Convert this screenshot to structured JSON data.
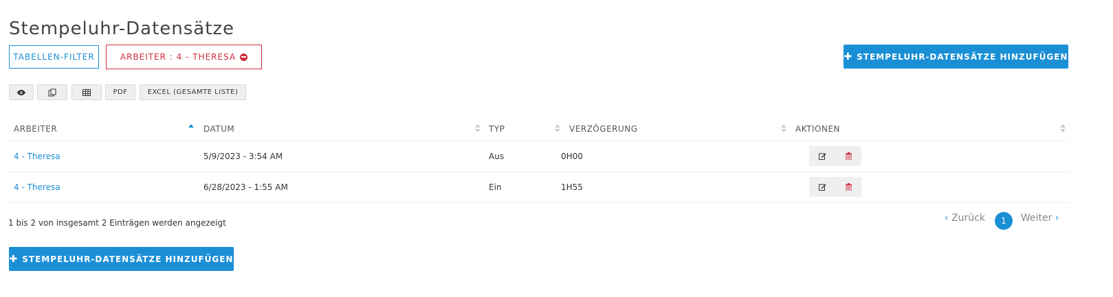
{
  "page": {
    "title": "Stempeluhr-Datensätze"
  },
  "filters": {
    "table_filter_label": "TABELLEN-FILTER",
    "active_filter_label": "ARBEITER : 4 - THERESA"
  },
  "actions": {
    "add_label": "STEMPELUHR-DATENSÄTZE HINZUFÜGEN"
  },
  "toolbar": {
    "view_icon": "eye-icon",
    "copy_icon": "copy-icon",
    "csv_icon": "table-icon",
    "pdf_label": "PDF",
    "excel_label": "EXCEL (GESAMTE LISTE)"
  },
  "table": {
    "columns": [
      "ARBEITER",
      "DATUM",
      "TYP",
      "VERZÖGERUNG",
      "AKTIONEN"
    ],
    "rows": [
      {
        "worker": "4 - Theresa",
        "date": "5/9/2023 - 3:54 AM",
        "type": "Aus",
        "delay": "0H00"
      },
      {
        "worker": "4 - Theresa",
        "date": "6/28/2023 - 1:55 AM",
        "type": "Ein",
        "delay": "1H55"
      }
    ]
  },
  "footer": {
    "info": "1 bis 2 von insgesamt 2 Einträgen werden angezeigt",
    "prev_label": "Zurück",
    "next_label": "Weiter",
    "current_page": "1"
  },
  "colors": {
    "primary": "#1a8fd6",
    "danger": "#d22c3f"
  }
}
